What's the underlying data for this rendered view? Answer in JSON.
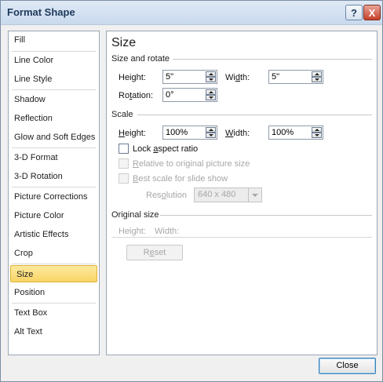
{
  "window": {
    "title": "Format Shape",
    "help_label": "?",
    "close_icon_label": "X"
  },
  "sidebar": {
    "items": [
      {
        "label": "Fill"
      },
      {
        "label": "Line Color"
      },
      {
        "label": "Line Style"
      },
      {
        "label": "Shadow"
      },
      {
        "label": "Reflection"
      },
      {
        "label": "Glow and Soft Edges"
      },
      {
        "label": "3-D Format"
      },
      {
        "label": "3-D Rotation"
      },
      {
        "label": "Picture Corrections"
      },
      {
        "label": "Picture Color"
      },
      {
        "label": "Artistic Effects"
      },
      {
        "label": "Crop"
      },
      {
        "label": "Size"
      },
      {
        "label": "Position"
      },
      {
        "label": "Text Box"
      },
      {
        "label": "Alt Text"
      }
    ],
    "selected": "Size"
  },
  "panel": {
    "heading": "Size",
    "size_rotate": {
      "group_label": "Size and rotate",
      "height_label_pre": "Hei",
      "height_label_u": "g",
      "height_label_post": "ht:",
      "height_value": "5\"",
      "width_label_pre": "Wi",
      "width_label_u": "d",
      "width_label_post": "th:",
      "width_value": "5\"",
      "rotation_label_pre": "Ro",
      "rotation_label_u": "t",
      "rotation_label_post": "ation:",
      "rotation_value": "0°"
    },
    "scale": {
      "group_label": "Scale",
      "height_label_pre": "",
      "height_label_u": "H",
      "height_label_post": "eight:",
      "height_value": "100%",
      "width_label_pre": "",
      "width_label_u": "W",
      "width_label_post": "idth:",
      "width_value": "100%",
      "lock_label_pre": "Lock ",
      "lock_label_u": "a",
      "lock_label_post": "spect ratio",
      "lock_checked": false,
      "relative_label_pre": "",
      "relative_label_u": "R",
      "relative_label_post": "elative to original picture size",
      "best_label_pre": "",
      "best_label_u": "B",
      "best_label_post": "est scale for slide show",
      "resolution_label_pre": "Res",
      "resolution_label_u": "o",
      "resolution_label_post": "lution",
      "resolution_value": "640 x 480"
    },
    "original": {
      "group_label": "Original size",
      "height_label": "Height:",
      "width_label": "Width:",
      "reset_label_pre": "R",
      "reset_label_u": "e",
      "reset_label_post": "set"
    }
  },
  "footer": {
    "close_label": "Close"
  }
}
